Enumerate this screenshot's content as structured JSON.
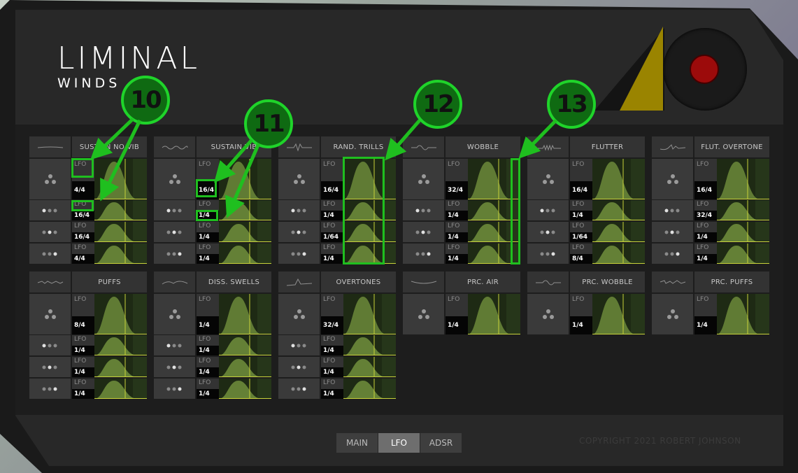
{
  "brand": {
    "title": "LIMINAL",
    "subtitle": "WINDS"
  },
  "lfo_label": "LFO",
  "colors": {
    "accent_green": "#1fbf1f",
    "knob_red": "#9c0b0b",
    "triangle_gold": "#9a8400",
    "graph_fill": "#6c8a3a"
  },
  "modules": [
    {
      "title": "SUSTAIN NO VIB",
      "icon": "flat-wave-icon",
      "rates": [
        "4/4",
        "16/4",
        "16/4",
        "4/4"
      ]
    },
    {
      "title": "SUSTAIN VIB",
      "icon": "vibrato-wave-icon",
      "rates": [
        "16/4",
        "1/4",
        "1/4",
        "1/4"
      ]
    },
    {
      "title": "RAND. TRILLS",
      "icon": "trill-wave-icon",
      "rates": [
        "16/4",
        "1/4",
        "1/64",
        "1/4"
      ]
    },
    {
      "title": "WOBBLE",
      "icon": "wobble-wave-icon",
      "rates": [
        "32/4",
        "1/4",
        "1/4",
        "1/4"
      ]
    },
    {
      "title": "FLUTTER",
      "icon": "flutter-wave-icon",
      "rates": [
        "16/4",
        "1/4",
        "1/64",
        "8/4"
      ]
    },
    {
      "title": "FLUT. OVERTONE",
      "icon": "flutter-overtone-wave-icon",
      "rates": [
        "16/4",
        "32/4",
        "1/4",
        "1/4"
      ]
    },
    {
      "title": "PUFFS",
      "icon": "puffs-wave-icon",
      "rates": [
        "8/4",
        "1/4",
        "1/4",
        "1/4"
      ]
    },
    {
      "title": "DISS. SWELLS",
      "icon": "swells-wave-icon",
      "rates": [
        "1/4",
        "1/4",
        "1/4",
        "1/4"
      ]
    },
    {
      "title": "OVERTONES",
      "icon": "overtones-wave-icon",
      "rates": [
        "32/4",
        "1/4",
        "1/4",
        "1/4"
      ]
    },
    {
      "title": "PRC. AIR",
      "icon": "air-wave-icon",
      "rates": [
        "1/4"
      ]
    },
    {
      "title": "PRC. WOBBLE",
      "icon": "prc-wobble-wave-icon",
      "rates": [
        "1/4"
      ]
    },
    {
      "title": "PRC. PUFFS",
      "icon": "prc-puffs-wave-icon",
      "rates": [
        "1/4"
      ]
    }
  ],
  "callouts": [
    "10",
    "11",
    "12",
    "13"
  ],
  "nav": {
    "tabs": [
      "MAIN",
      "LFO",
      "ADSR"
    ],
    "active": "LFO"
  },
  "copyright": "COPYRIGHT 2021 ROBERT JOHNSON"
}
